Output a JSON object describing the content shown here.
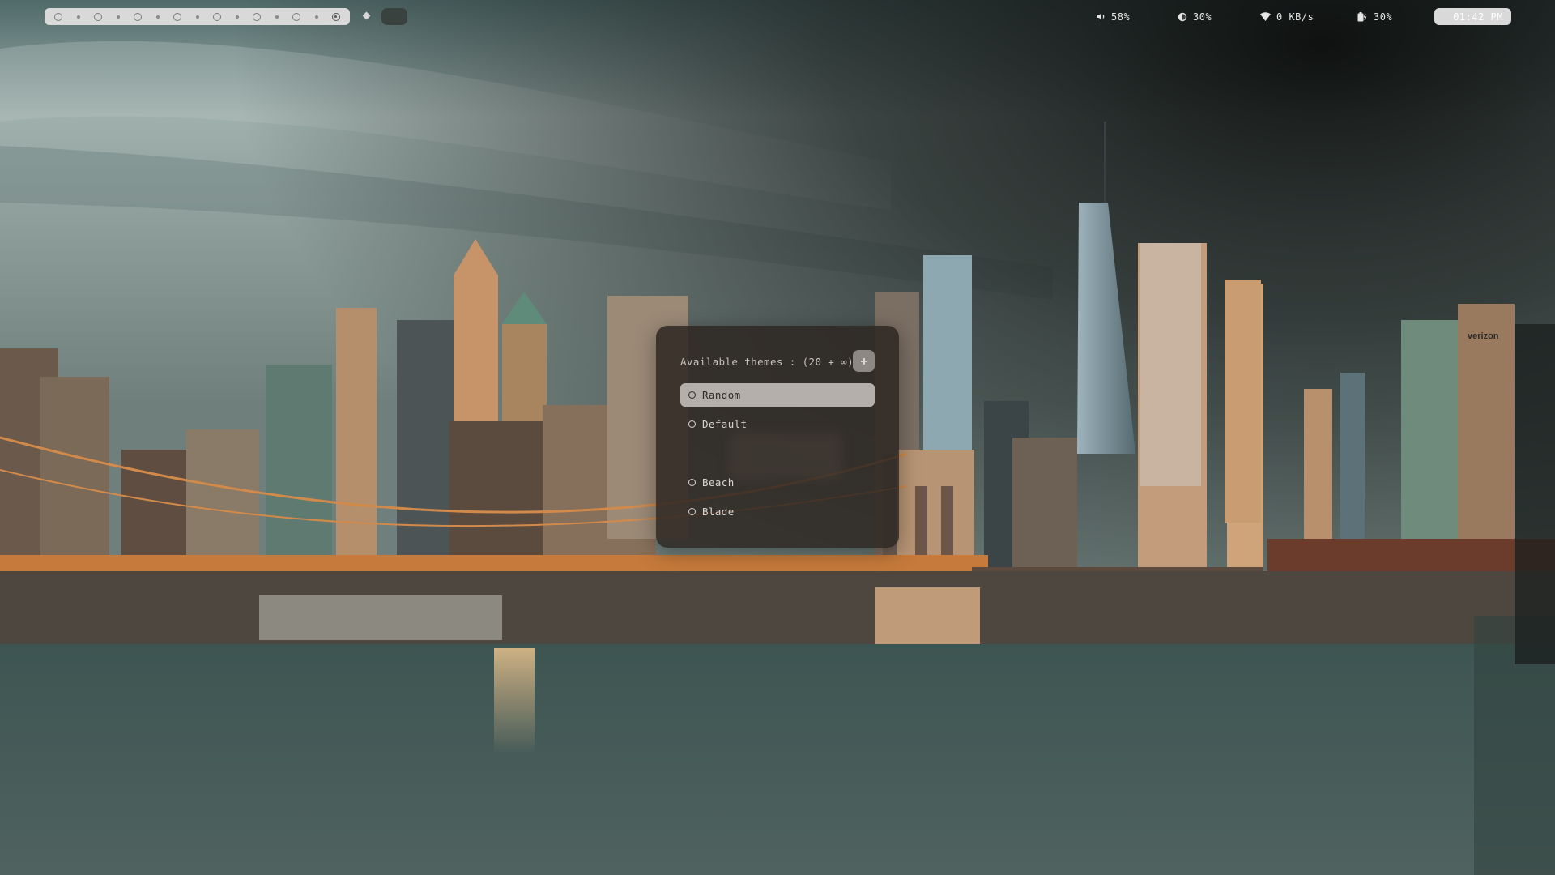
{
  "topbar": {
    "workspaces": {
      "count": 8,
      "active_index": 7
    },
    "volume": {
      "icon": "speaker-icon",
      "value": "58%"
    },
    "brightness": {
      "icon": "brightness-icon",
      "value": "30%"
    },
    "network": {
      "icon": "wifi-icon",
      "value": "0 KB/s"
    },
    "battery": {
      "icon": "battery-charging-icon",
      "value": "30%"
    },
    "clock": "01:42 PM"
  },
  "theme_picker": {
    "header": "Available themes : (20 + ∞)",
    "action_icon": "plus-icon",
    "items": [
      {
        "label": "Random",
        "selected": true
      },
      {
        "label": "Default",
        "selected": false
      },
      {
        "label": "Beach",
        "selected": false
      },
      {
        "label": "Blade",
        "selected": false
      }
    ]
  },
  "wallpaper": {
    "subject": "city-skyline-bridge",
    "sign_text": "verizon"
  },
  "colors": {
    "bar_pill": "#d9d9d9",
    "panel_bg": "#2d2622",
    "selected_row": "#b4afab",
    "bridge": "#c9783a",
    "water": "#3b5350"
  }
}
